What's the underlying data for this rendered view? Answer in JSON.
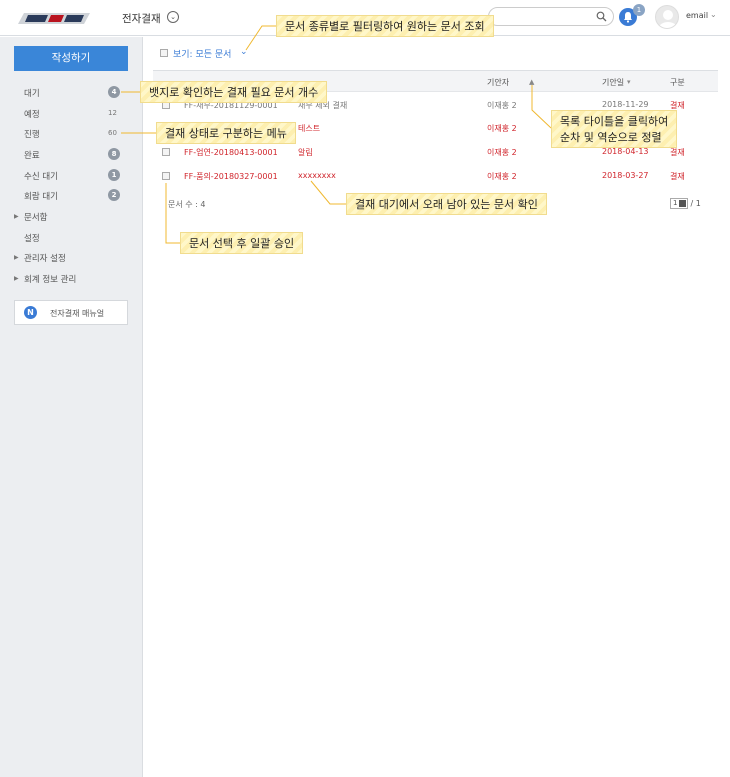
{
  "header": {
    "app_title": "전자결재",
    "title_chevron": "⌄",
    "notification_count": "1",
    "user_label": "email",
    "user_chevron": "⌄"
  },
  "sidebar": {
    "compose_label": "작성하기",
    "items": [
      {
        "label": "대기",
        "count": "4",
        "count_style": "badge"
      },
      {
        "label": "예정",
        "count": "12",
        "count_style": "plain"
      },
      {
        "label": "진행",
        "count": "60",
        "count_style": "plain"
      },
      {
        "label": "완료",
        "count": "8",
        "count_style": "badge"
      },
      {
        "label": "수신 대기",
        "count": "1",
        "count_style": "badge"
      },
      {
        "label": "회람 대기",
        "count": "2",
        "count_style": "badge"
      }
    ],
    "folder_items": [
      {
        "label": "문서함",
        "has_arrow": true
      },
      {
        "label": "설정",
        "has_arrow": false
      },
      {
        "label": "관리자 설정",
        "has_arrow": true
      },
      {
        "label": "회계 정보 관리",
        "has_arrow": true
      }
    ],
    "manual_icon": "N",
    "manual_label": "전자결재 매뉴얼"
  },
  "main": {
    "filter_label": "보기: 모든 문서",
    "filter_chevron": "⌄",
    "columns": {
      "drafter": "기안자",
      "draft_date": "기안일",
      "draft_date_sort": "▾",
      "category": "구분"
    },
    "rows": [
      {
        "doc_no": "FF-재무-20181129-0001",
        "title": "재무 제외 결재",
        "drafter": "이재홍 2",
        "date": "2018-11-29",
        "category": "결재",
        "highlight": false
      },
      {
        "doc_no": "",
        "title": "테스트",
        "drafter": "이재홍 2",
        "date": "",
        "category": "",
        "highlight": true
      },
      {
        "doc_no": "FF-업연-20180413-0001",
        "title": "알림",
        "drafter": "이재홍 2",
        "date": "2018-04-13",
        "category": "결재",
        "highlight": true
      },
      {
        "doc_no": "FF-품의-20180327-0001",
        "title": "xxxxxxxx",
        "drafter": "이재홍 2",
        "date": "2018-03-27",
        "category": "결재",
        "highlight": true
      }
    ],
    "doc_count_label": "문서 수 : 4",
    "page_current": "1",
    "page_total": "/ 1"
  },
  "callouts": {
    "filter_tip": "문서 종류별로 필터링하여 원하는 문서 조회",
    "badge_tip": "뱃지로 확인하는 결재 필요 문서 개수",
    "status_tip": "결재 상태로 구분하는 메뉴",
    "sort_tip_line1": "목록 타이틀을 클릭하여",
    "sort_tip_line2": "순차 및 역순으로 정렬",
    "old_doc_tip": "결재 대기에서 오래 남아 있는 문서 확인",
    "bulk_tip": "문서 선택 후 일괄 승인"
  },
  "colors": {
    "accent": "#3a86d8",
    "urgent": "#d0242b",
    "callout": "#fff7c9",
    "sidebar_bg": "#eceef1"
  }
}
